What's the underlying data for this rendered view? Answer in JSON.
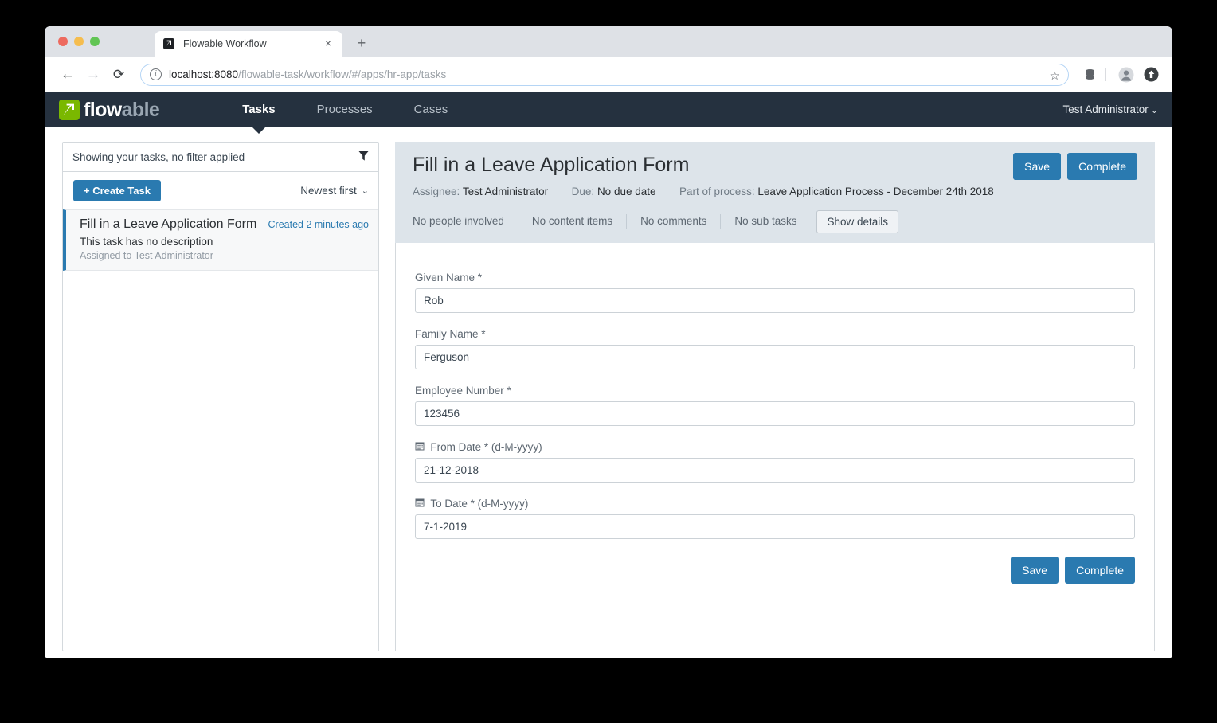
{
  "browser": {
    "tab_title": "Flowable Workflow",
    "tab_favicon": "flowable-favicon-icon",
    "new_tab_label": "+",
    "close_label": "×",
    "back_icon": "←",
    "forward_icon": "→",
    "reload_icon": "⟳",
    "url_host": "localhost:8080",
    "url_path": "/flowable-task/workflow/#/apps/hr-app/tasks",
    "star_icon": "☆",
    "toolbar_icons": [
      "database-stack-icon",
      "profile-avatar-icon",
      "update-arrow-icon"
    ]
  },
  "navbar": {
    "logo_primary": "flow",
    "logo_secondary": "able",
    "links": [
      {
        "label": "Tasks",
        "active": true
      },
      {
        "label": "Processes",
        "active": false
      },
      {
        "label": "Cases",
        "active": false
      }
    ],
    "user": "Test Administrator",
    "user_caret": "⌄"
  },
  "task_panel": {
    "filter_text": "Showing your tasks, no filter applied",
    "filter_icon": "filter-funnel-icon",
    "create_task_label": "+ Create Task",
    "sort_label": "Newest first",
    "sort_caret": "⌄",
    "tasks": [
      {
        "name": "Fill in a Leave Application Form",
        "created": "Created 2 minutes ago",
        "description": "This task has no description",
        "assignee": "Assigned to Test Administrator"
      }
    ]
  },
  "detail": {
    "title": "Fill in a Leave Application Form",
    "assignee_label": "Assignee:",
    "assignee_value": "Test Administrator",
    "due_label": "Due:",
    "due_value": "No due date",
    "process_label": "Part of process:",
    "process_value": "Leave Application Process - December 24th 2018",
    "save_label": "Save",
    "complete_label": "Complete",
    "tabs": [
      "No people involved",
      "No content items",
      "No comments",
      "No sub tasks"
    ],
    "show_details_label": "Show details"
  },
  "form": {
    "fields": [
      {
        "label": "Given Name *",
        "value": "Rob",
        "icon": null
      },
      {
        "label": "Family Name *",
        "value": "Ferguson",
        "icon": null
      },
      {
        "label": "Employee Number *",
        "value": "123456",
        "icon": null
      },
      {
        "label": "From Date * (d-M-yyyy)",
        "value": "21-12-2018",
        "icon": "calendar-icon"
      },
      {
        "label": "To Date * (d-M-yyyy)",
        "value": "7-1-2019",
        "icon": "calendar-icon"
      }
    ],
    "save_label": "Save",
    "complete_label": "Complete"
  },
  "colors": {
    "accent": "#2a7ab0",
    "navbar": "#25313f",
    "logo_green": "#7ab800",
    "header_bg": "#dde4ea"
  }
}
